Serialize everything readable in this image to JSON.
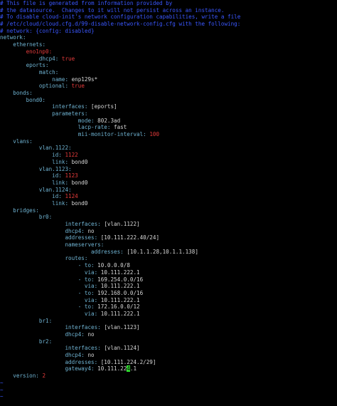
{
  "comments": [
    "# This file is generated from information provided by",
    "# the datasource.  Changes to it will not persist across an instance.",
    "# To disable cloud-init's network configuration capabilities, write a file",
    "# /etc/cloud/cloud.cfg.d/99-disable-network-config.cfg with the following:",
    "# network: {config: disabled}"
  ],
  "yaml": {
    "network": "network:",
    "ethernets": "ethernets:",
    "eno1_key": "eno1np0:",
    "eno1_dhcp_key": "dhcp4:",
    "eno1_dhcp_val": "true",
    "eports": "eports:",
    "match": "match:",
    "name_key": "name:",
    "name_val": "enp129s*",
    "optional_key": "optional:",
    "optional_val": "true",
    "bonds": "bonds:",
    "bond0": "bond0:",
    "bond_interfaces_key": "interfaces:",
    "bond_interfaces_val": "[eports]",
    "parameters": "parameters:",
    "mode_key": "mode:",
    "mode_val": "802.3ad",
    "lacp_key": "lacp-rate:",
    "lacp_val": "fast",
    "mii_key": "mii-monitor-interval:",
    "mii_val": "100",
    "vlans": "vlans:",
    "vlan1122": "vlan.1122:",
    "vlan1122_id_key": "id:",
    "vlan1122_id_val": "1122",
    "vlan1122_link_key": "link:",
    "vlan1122_link_val": "bond0",
    "vlan1123": "vlan.1123:",
    "vlan1123_id_key": "id:",
    "vlan1123_id_val": "1123",
    "vlan1123_link_key": "link:",
    "vlan1123_link_val": "bond0",
    "vlan1124": "vlan.1124:",
    "vlan1124_id_key": "id:",
    "vlan1124_id_val": "1124",
    "vlan1124_link_key": "link:",
    "vlan1124_link_val": "bond0",
    "bridges": "bridges:",
    "br0": "br0:",
    "br0_interfaces_key": "interfaces:",
    "br0_interfaces_val": "[vlan.1122]",
    "br0_dhcp_key": "dhcp4:",
    "br0_dhcp_val": "no",
    "br0_addresses_key": "addresses:",
    "br0_addresses_val": "[10.111.222.40/24]",
    "nameservers": "nameservers:",
    "ns_addresses_key": "addresses:",
    "ns_addresses_val": "[10.1.1.28,10.1.1.138]",
    "routes": "routes:",
    "route1_to_key": "- to:",
    "route1_to_val": "10.0.0.0/8",
    "route1_via_key": "via:",
    "route1_via_val": "10.111.222.1",
    "route2_to_key": "- to:",
    "route2_to_val": "169.254.0.0/16",
    "route2_via_key": "via:",
    "route2_via_val": "10.111.222.1",
    "route3_to_key": "- to:",
    "route3_to_val": "192.168.0.0/16",
    "route3_via_key": "via:",
    "route3_via_val": "10.111.222.1",
    "route4_to_key": "- to:",
    "route4_to_val": "172.16.0.0/12",
    "route4_via_key": "via:",
    "route4_via_val": "10.111.222.1",
    "br1": "br1:",
    "br1_interfaces_key": "interfaces:",
    "br1_interfaces_val": "[vlan.1123]",
    "br1_dhcp_key": "dhcp4:",
    "br1_dhcp_val": "no",
    "br2": "br2:",
    "br2_interfaces_key": "interfaces:",
    "br2_interfaces_val": "[vlan.1124]",
    "br2_dhcp_key": "dhcp4:",
    "br2_dhcp_val": "no",
    "br2_addresses_key": "addresses:",
    "br2_addresses_val": "[10.111.224.2/29]",
    "gateway_key": "gateway4:",
    "gateway_val_before": "10.111.22",
    "gateway_val_cursor": "4",
    "gateway_val_after": ".1",
    "version_key": "version:",
    "version_val": "2"
  },
  "tilde": "~",
  "colors": {
    "background": "#000000",
    "comment": "#3a57ff",
    "key": "#6fb3d2",
    "value": "#d7d7d7",
    "number": "#e53b3b",
    "cursor": "#2ee02e"
  }
}
